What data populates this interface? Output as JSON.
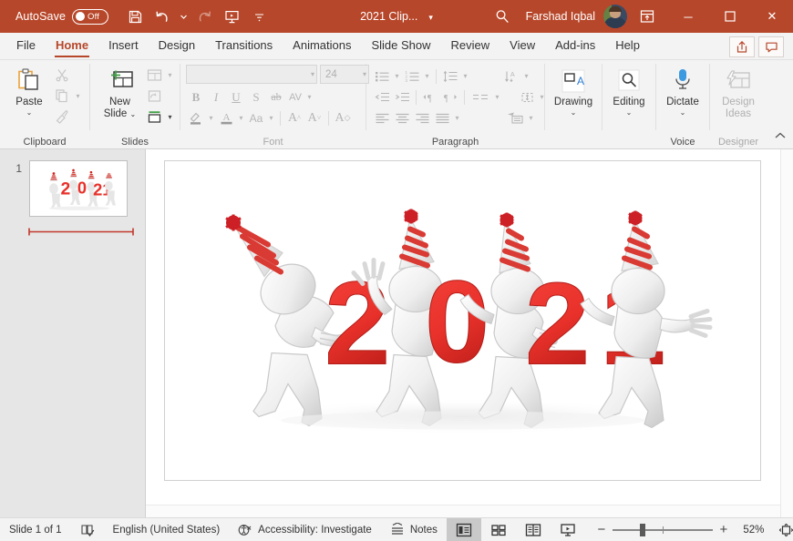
{
  "titlebar": {
    "autosave_label": "AutoSave",
    "autosave_state": "Off",
    "save_icon": "save-icon",
    "undo_icon": "undo-icon",
    "redo_icon": "redo-icon",
    "present_icon": "start-presentation-icon",
    "more_icon": "customize-quick-access-icon",
    "document_title": "2021 Clip...",
    "title_caret": "▾",
    "search_icon": "search-icon",
    "account_name": "Farshad Iqbal",
    "ribbon_display_icon": "ribbon-display-options-icon",
    "minimize": "─",
    "maximize": "☐",
    "close": "✕"
  },
  "tabs": [
    {
      "label": "File",
      "active": false
    },
    {
      "label": "Home",
      "active": true
    },
    {
      "label": "Insert",
      "active": false
    },
    {
      "label": "Design",
      "active": false
    },
    {
      "label": "Transitions",
      "active": false
    },
    {
      "label": "Animations",
      "active": false
    },
    {
      "label": "Slide Show",
      "active": false
    },
    {
      "label": "Review",
      "active": false
    },
    {
      "label": "View",
      "active": false
    },
    {
      "label": "Add-ins",
      "active": false
    },
    {
      "label": "Help",
      "active": false
    }
  ],
  "tabs_right": {
    "share_icon": "share-icon",
    "comments_icon": "comments-icon"
  },
  "ribbon": {
    "clipboard": {
      "label": "Clipboard",
      "paste_label": "Paste",
      "paste_caret": "⌄",
      "cut_icon": "cut-icon",
      "copy_icon": "copy-icon",
      "format_painter_icon": "format-painter-icon",
      "dialog_launcher": "dialog-launcher-icon"
    },
    "slides": {
      "label": "Slides",
      "new_slide_label_1": "New",
      "new_slide_label_2": "Slide",
      "new_slide_caret": "⌄",
      "layout_icon": "slide-layout-icon",
      "reset_icon": "reset-slide-icon",
      "section_icon": "section-icon"
    },
    "font": {
      "label": "Font",
      "font_name_value": "",
      "font_size_value": "24",
      "bold": "B",
      "italic": "I",
      "underline": "U",
      "shadow": "S",
      "strikethrough": "ab",
      "char_spacing": "AV",
      "text_highlight_icon": "text-highlight-icon",
      "font_color_icon": "font-color-icon",
      "change_case": "Aa",
      "increase_size": "A",
      "decrease_size": "A",
      "clear_format_icon": "clear-formatting-icon",
      "dialog_launcher": "dialog-launcher-icon"
    },
    "paragraph": {
      "label": "Paragraph",
      "bullets_icon": "bullets-icon",
      "numbering_icon": "numbering-icon",
      "line_spacing_icon": "line-spacing-icon",
      "text_direction_icon": "text-direction-icon",
      "decrease_indent_icon": "decrease-indent-icon",
      "increase_indent_icon": "increase-indent-icon",
      "ltr_icon": "left-to-right-icon",
      "rtl_icon": "right-to-left-icon",
      "columns_icon": "columns-icon",
      "align_text_icon": "align-text-icon",
      "align_left_icon": "align-left-icon",
      "align_center_icon": "align-center-icon",
      "align_right_icon": "align-right-icon",
      "justify_icon": "justify-icon",
      "smartart_icon": "convert-to-smartart-icon",
      "dialog_launcher": "dialog-launcher-icon"
    },
    "drawing": {
      "label": "Drawing",
      "caret": "⌄",
      "icon": "drawing-icon"
    },
    "editing": {
      "label": "Editing",
      "caret": "⌄",
      "icon": "editing-find-icon"
    },
    "voice": {
      "label": "Voice",
      "dictate_label": "Dictate",
      "caret": "⌄",
      "icon": "microphone-icon"
    },
    "designer": {
      "label": "Designer",
      "design_ideas_line1": "Design",
      "design_ideas_line2": "Ideas",
      "icon": "design-ideas-icon"
    },
    "collapse_icon": "collapse-ribbon-icon"
  },
  "thumbnails": [
    {
      "number": "1",
      "selected": true
    }
  ],
  "slide": {
    "artwork_name": "2021-new-year-party-clipart",
    "numerals": "2021",
    "accent_red": "#e8312a",
    "hat_red": "#cc2026",
    "figure_gray": "#e4e4e4"
  },
  "status": {
    "slide_count": "Slide 1 of 1",
    "spellcheck_icon": "spell-check-icon",
    "language": "English (United States)",
    "accessibility_icon": "accessibility-icon",
    "accessibility": "Accessibility: Investigate",
    "notes_icon": "notes-icon",
    "notes_label": "Notes",
    "view_normal_icon": "normal-view-icon",
    "view_sorter_icon": "slide-sorter-icon",
    "view_reading_icon": "reading-view-icon",
    "view_slideshow_icon": "slideshow-view-icon",
    "zoom_out": "−",
    "zoom_in": "+",
    "zoom_percent": "52%",
    "fit_icon": "fit-slide-to-window-icon"
  },
  "colors": {
    "title_bar": "#b7472a",
    "accent": "#b7472a",
    "ribbon_bg": "#f3f3f3",
    "thumb_pane": "#e6e6e6"
  }
}
